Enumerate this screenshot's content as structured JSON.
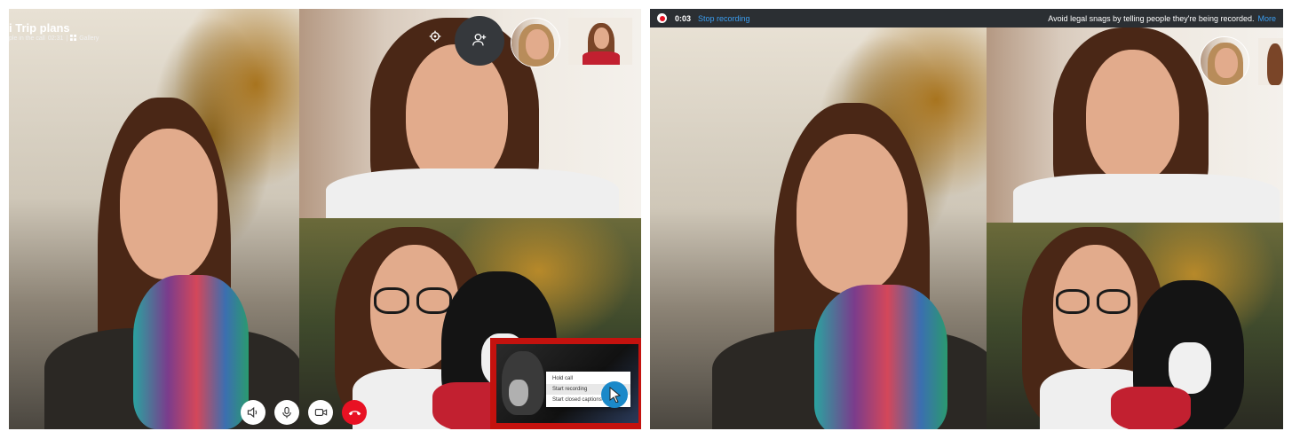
{
  "call": {
    "title": "i Trip plans",
    "subtitle_people": "ple in the call",
    "subtitle_duration": "02:31",
    "subtitle_separator": "|",
    "subtitle_view": "Gallery"
  },
  "controls": {
    "icons": [
      "speaker-icon",
      "microphone-icon",
      "video-camera-icon",
      "end-call-icon"
    ],
    "end_call_color": "#e81123"
  },
  "context_menu": {
    "items": [
      "Hold call",
      "Start recording",
      "Start closed captions"
    ],
    "highlight_color": "#c4120e"
  },
  "recording_bar": {
    "time": "0:03",
    "stop_label": "Stop recording",
    "notice": "Avoid legal snags by telling people they're being recorded.",
    "more_label": "More",
    "link_color": "#3b9ef0"
  }
}
